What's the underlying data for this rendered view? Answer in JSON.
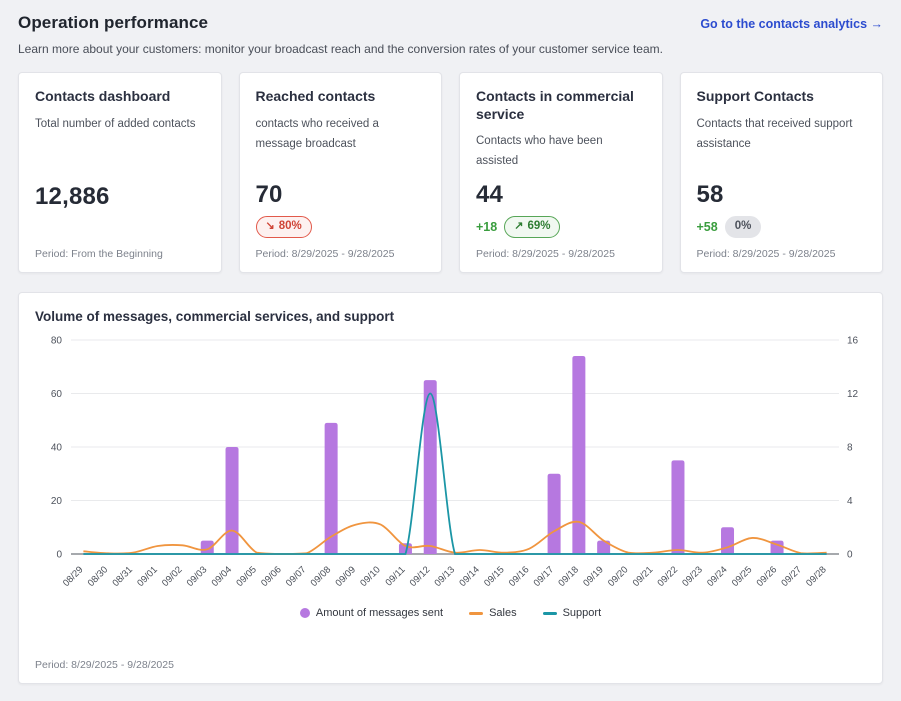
{
  "header": {
    "title": "Operation performance",
    "subtitle": "Learn more about your customers: monitor your broadcast reach and the conversion rates of your customer service team.",
    "link_label": "Go to the contacts analytics →"
  },
  "cards": [
    {
      "title": "Contacts dashboard",
      "description": "Total number of added contacts",
      "value": "12,886",
      "period": "Period: From the Beginning"
    },
    {
      "title": "Reached contacts",
      "description": "contacts who received a message broadcast",
      "value": "70",
      "badge": {
        "type": "negative",
        "arrow": "↘",
        "value": "80%"
      },
      "period": "Period: 8/29/2025 - 9/28/2025"
    },
    {
      "title": "Contacts in commercial service",
      "description": "Contacts who have been assisted",
      "value": "44",
      "delta": "+18",
      "badge": {
        "type": "positive",
        "arrow": "↗",
        "value": "69%"
      },
      "period": "Period: 8/29/2025 - 9/28/2025"
    },
    {
      "title": "Support Contacts",
      "description": "Contacts that received support assistance",
      "value": "58",
      "delta": "+58",
      "badge": {
        "type": "neutral",
        "arrow": "",
        "value": "0%"
      },
      "period": "Period: 8/29/2025 - 9/28/2025"
    }
  ],
  "chart_card": {
    "title": "Volume of messages, commercial services, and support",
    "period": "Period: 8/29/2025 - 9/28/2025"
  },
  "chart_data": {
    "type": "bar",
    "title": "Volume of messages, commercial services, and support",
    "categories": [
      "08/29",
      "08/30",
      "08/31",
      "09/01",
      "09/02",
      "09/03",
      "09/04",
      "09/05",
      "09/06",
      "09/07",
      "09/08",
      "09/09",
      "09/10",
      "09/11",
      "09/12",
      "09/13",
      "09/14",
      "09/15",
      "09/16",
      "09/17",
      "09/18",
      "09/19",
      "09/20",
      "09/21",
      "09/22",
      "09/23",
      "09/24",
      "09/25",
      "09/26",
      "09/27",
      "09/28"
    ],
    "left_axis": {
      "min": 0,
      "max": 80,
      "ticks": [
        0,
        20,
        40,
        60,
        80
      ]
    },
    "right_axis": {
      "min": 0,
      "max": 16,
      "ticks": [
        0,
        4,
        8,
        12,
        16
      ]
    },
    "grid": true,
    "legend_position": "bottom",
    "series": [
      {
        "name": "Amount of messages sent",
        "type": "bar",
        "axis": "left",
        "color": "#b678e0",
        "values": [
          0,
          0,
          0,
          0,
          0,
          5,
          40,
          0,
          0,
          0,
          49,
          0,
          0,
          4,
          65,
          0,
          0,
          0,
          0,
          30,
          74,
          5,
          0,
          0,
          35,
          0,
          10,
          0,
          5,
          0,
          0
        ]
      },
      {
        "name": "Sales",
        "type": "line",
        "axis": "right",
        "color": "#f0953f",
        "values": [
          0.2,
          0.05,
          0.1,
          0.6,
          0.65,
          0.35,
          1.75,
          0.1,
          0,
          0.05,
          1.3,
          2.2,
          2.2,
          0.6,
          0.6,
          0.1,
          0.3,
          0.1,
          0.4,
          1.7,
          2.4,
          1,
          0.1,
          0.1,
          0.3,
          0.1,
          0.5,
          1.2,
          0.7,
          0.05,
          0.1
        ]
      },
      {
        "name": "Support",
        "type": "line",
        "axis": "right",
        "color": "#1b96a6",
        "values": [
          0,
          0,
          0,
          0,
          0,
          0,
          0,
          0,
          0,
          0,
          0,
          0,
          0,
          0,
          12,
          0,
          0,
          0,
          0,
          0,
          0,
          0,
          0,
          0,
          0,
          0,
          0,
          0,
          0,
          0,
          0
        ]
      }
    ]
  },
  "colors": {
    "accent_link": "#2c4ccf",
    "bar": "#b678e0",
    "sales_line": "#f0953f",
    "support_line": "#1b96a6",
    "negative": "#cf4436",
    "positive": "#2e7d32",
    "grid": "#e9eaec",
    "axis": "#a6a9ad"
  }
}
